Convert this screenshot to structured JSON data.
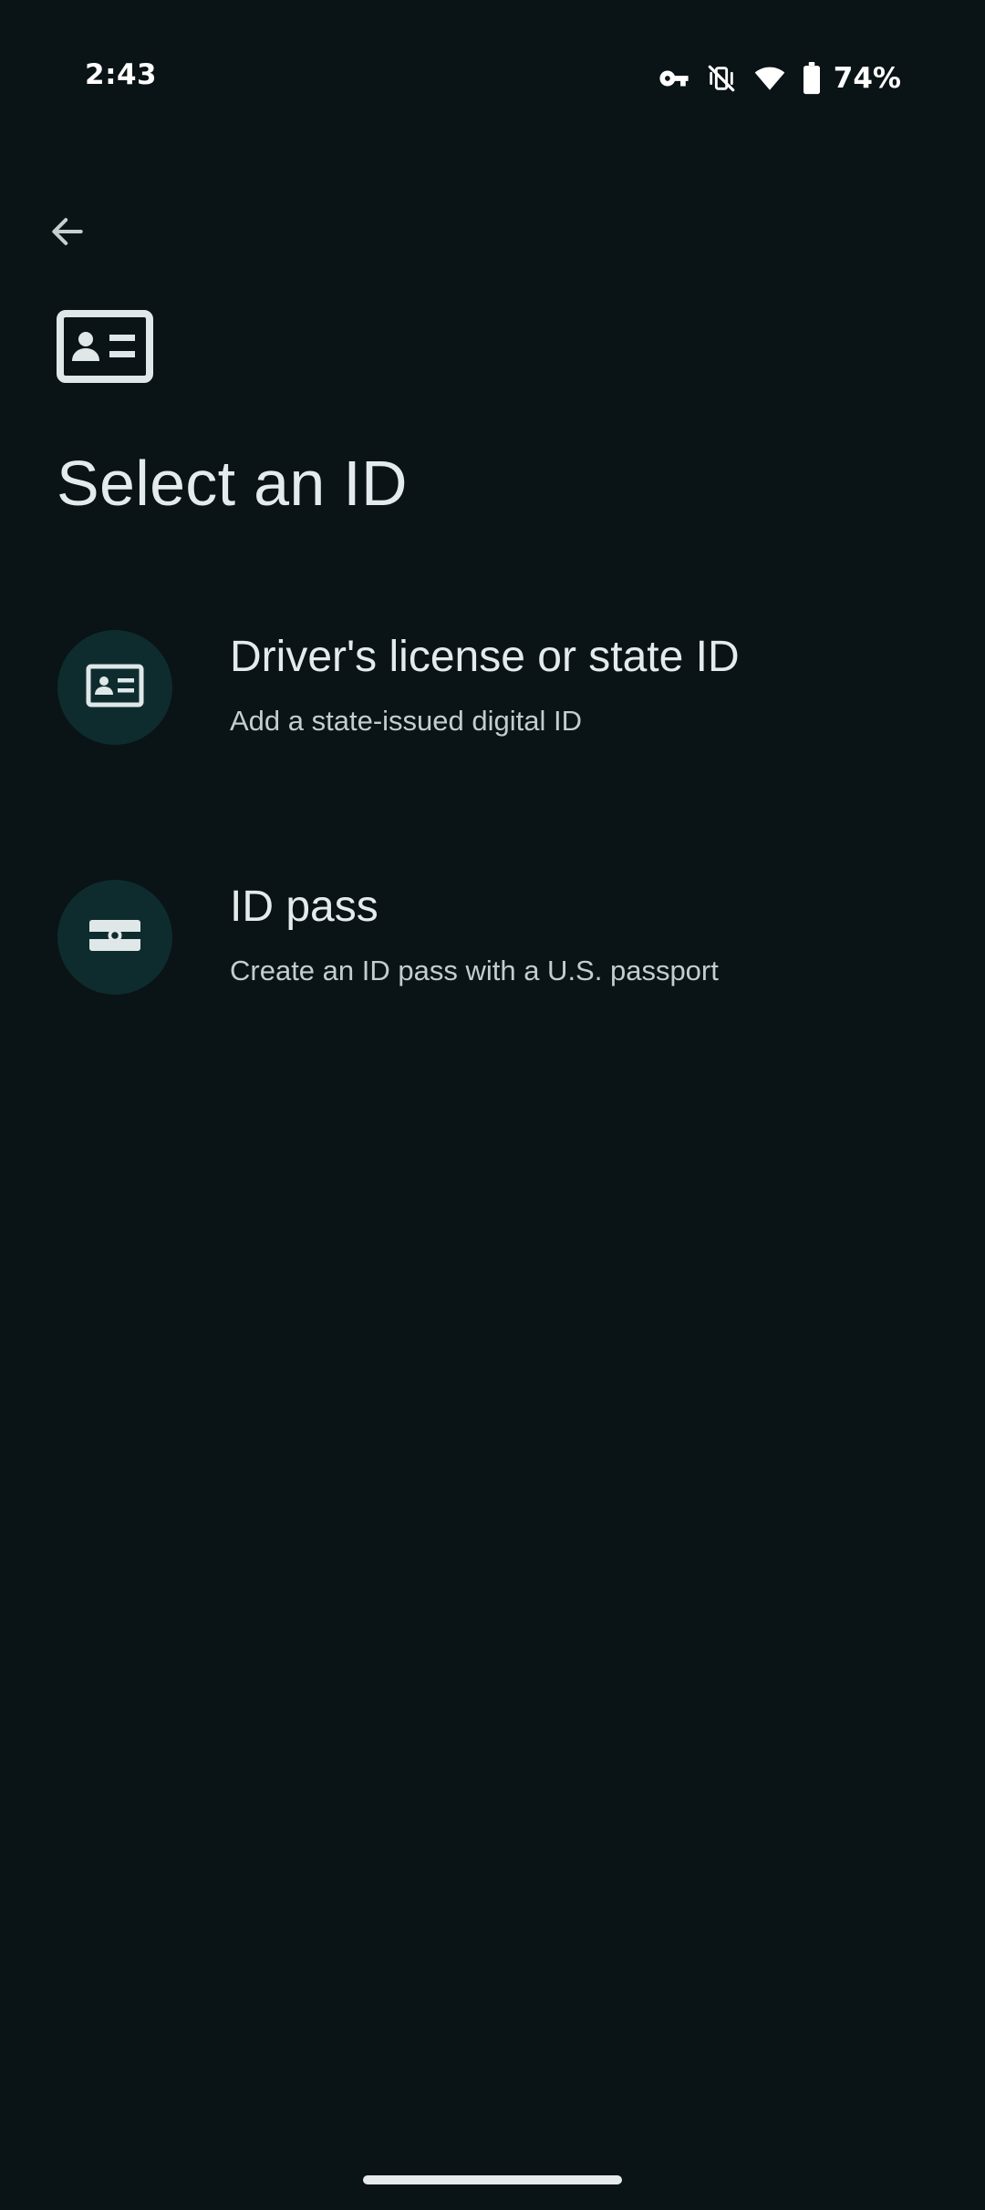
{
  "status_bar": {
    "time": "2:43",
    "battery_percent": "74%",
    "icons": [
      "vpn-key-icon",
      "vibrate-off-icon",
      "wifi-icon",
      "battery-icon"
    ]
  },
  "toolbar": {
    "back_icon": "arrow-back-icon"
  },
  "header": {
    "icon": "id-card-icon",
    "title": "Select an ID"
  },
  "options": [
    {
      "icon": "id-card-icon",
      "title": "Driver's license or state ID",
      "subtitle": "Add a state-issued digital ID"
    },
    {
      "icon": "id-pass-icon",
      "title": "ID pass",
      "subtitle": "Create an ID pass with a U.S. passport"
    }
  ],
  "colors": {
    "background": "#0a1316",
    "icon_circle": "#0e2c2e",
    "text_primary": "#e4ebec",
    "text_secondary": "#c4cdce"
  }
}
